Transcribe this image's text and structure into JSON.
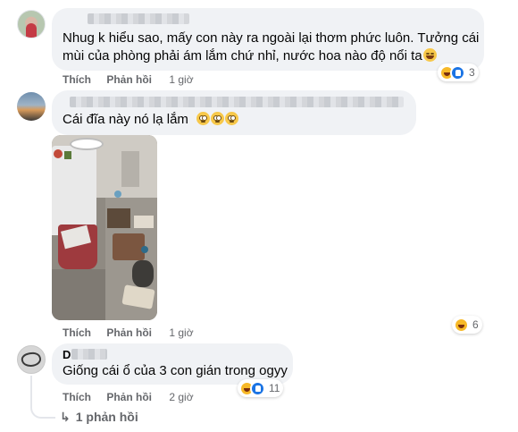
{
  "comments": [
    {
      "text_line1": "Nhug k hiểu sao, mấy con này ra ngoài lại thơm phức luôn. Tưởng cái",
      "text_line2": "mùi của phòng phải ám lắm chứ nhỉ, nước hoa nào độ nổi ta",
      "emoji": [
        "grinning-sweat-emoji"
      ],
      "like_label": "Thích",
      "reply_label": "Phản hồi",
      "time": "1 giờ",
      "reactions": [
        "haha",
        "like"
      ],
      "reaction_count": "3"
    },
    {
      "text": "Cái đĩa này nó lạ lắm",
      "emoji": [
        "rolling-eyes-emoji",
        "rolling-eyes-emoji",
        "rolling-eyes-emoji"
      ],
      "like_label": "Thích",
      "reply_label": "Phản hồi",
      "time": "1 giờ",
      "reactions": [
        "haha"
      ],
      "reaction_count": "6"
    },
    {
      "author_initial": "D",
      "text": "Giống cái ổ của 3 con gián trong ogyy",
      "like_label": "Thích",
      "reply_label": "Phản hồi",
      "time": "2 giờ",
      "reactions": [
        "haha",
        "like"
      ],
      "reaction_count": "11",
      "replies_label": "1 phản hồi",
      "replies_icon": "reply-arrow-icon"
    }
  ]
}
